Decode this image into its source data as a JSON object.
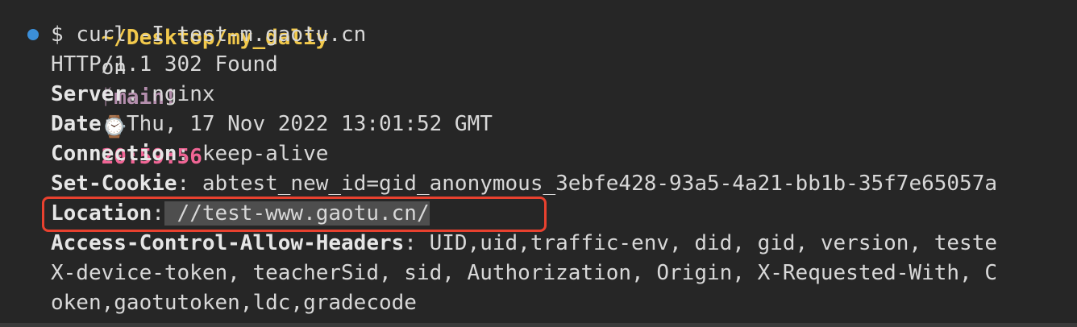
{
  "prompt": {
    "path": "~/Desktop/my_daliy",
    "on": "on",
    "branch_icon": "git-branch-icon",
    "branch": "main!",
    "clock_icon": "clock-icon",
    "time": "20:59:56"
  },
  "command": {
    "dollar": "$",
    "text": "curl -I test-m.gaotu.cn"
  },
  "response": {
    "status": "HTTP/1.1 302 Found",
    "headers": [
      {
        "key": "Server",
        "value": ": nginx"
      },
      {
        "key": "Date",
        "value": ": Thu, 17 Nov 2022 13:01:52 GMT"
      },
      {
        "key": "Connection",
        "value": ": keep-alive"
      },
      {
        "key": "Set-Cookie",
        "value": ": abtest_new_id=gid_anonymous_3ebfe428-93a5-4a21-bb1b-35f7e65057a"
      },
      {
        "key": "Location",
        "value_plain": ":",
        "value_selected": " //test-www.gaotu.cn/"
      },
      {
        "key": "Access-Control-Allow-Headers",
        "value": ": UID,uid,traffic-env, did, gid, version, teste"
      }
    ],
    "continuation": [
      "X-device-token, teacherSid, sid, Authorization, Origin, X-Requested-With, C",
      "oken,gaotutoken,ldc,gradecode"
    ]
  },
  "colors": {
    "background": "#262626",
    "highlight_box": "#e8412f",
    "status_dot": "#3b8fd9",
    "path": "#f2c94c",
    "branch": "#b48ead",
    "time": "#f06595"
  }
}
